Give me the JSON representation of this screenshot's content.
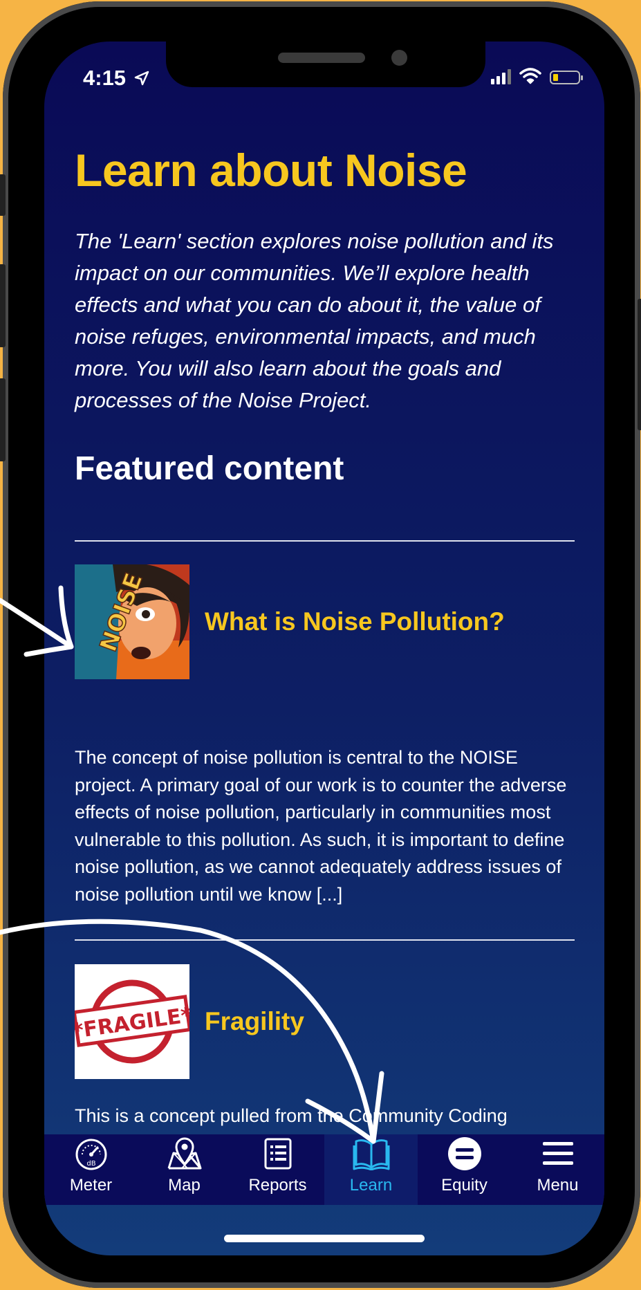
{
  "status_bar": {
    "time": "4:15"
  },
  "page": {
    "title": "Learn about Noise",
    "intro": "The 'Learn' section explores noise pollution and its impact on our communities. We’ll explore health effects and what you can do about it, the value of noise refuges, environmental impacts, and much more. You will also learn about the goals and processes of the Noise Project.",
    "featured_heading": "Featured content"
  },
  "articles": [
    {
      "title": "What is Noise Pollution?",
      "excerpt": "The concept of noise pollution is central to the NOISE project. A primary goal of our work is to counter the adverse effects of noise pollution, particularly in communities most vulnerable to this pollution. As such, it is important to define noise pollution, as we cannot adequately address issues of noise pollution until we know [...]",
      "thumb_text": "NOISE"
    },
    {
      "title": "Fragility",
      "excerpt": "This is a concept pulled from the Community Coding",
      "thumb_text": "*FRAGILE*"
    }
  ],
  "tabs": [
    {
      "label": "Meter",
      "icon": "gauge-icon",
      "sub": "dB"
    },
    {
      "label": "Map",
      "icon": "map-pin-icon"
    },
    {
      "label": "Reports",
      "icon": "list-icon"
    },
    {
      "label": "Learn",
      "icon": "book-icon",
      "active": true
    },
    {
      "label": "Equity",
      "icon": "equals-icon"
    },
    {
      "label": "Menu",
      "icon": "hamburger-icon"
    }
  ],
  "colors": {
    "background": "#f6b445",
    "accent": "#f7c71f",
    "active_tab": "#29b8ef",
    "tabbar": "#0a0b5a"
  }
}
